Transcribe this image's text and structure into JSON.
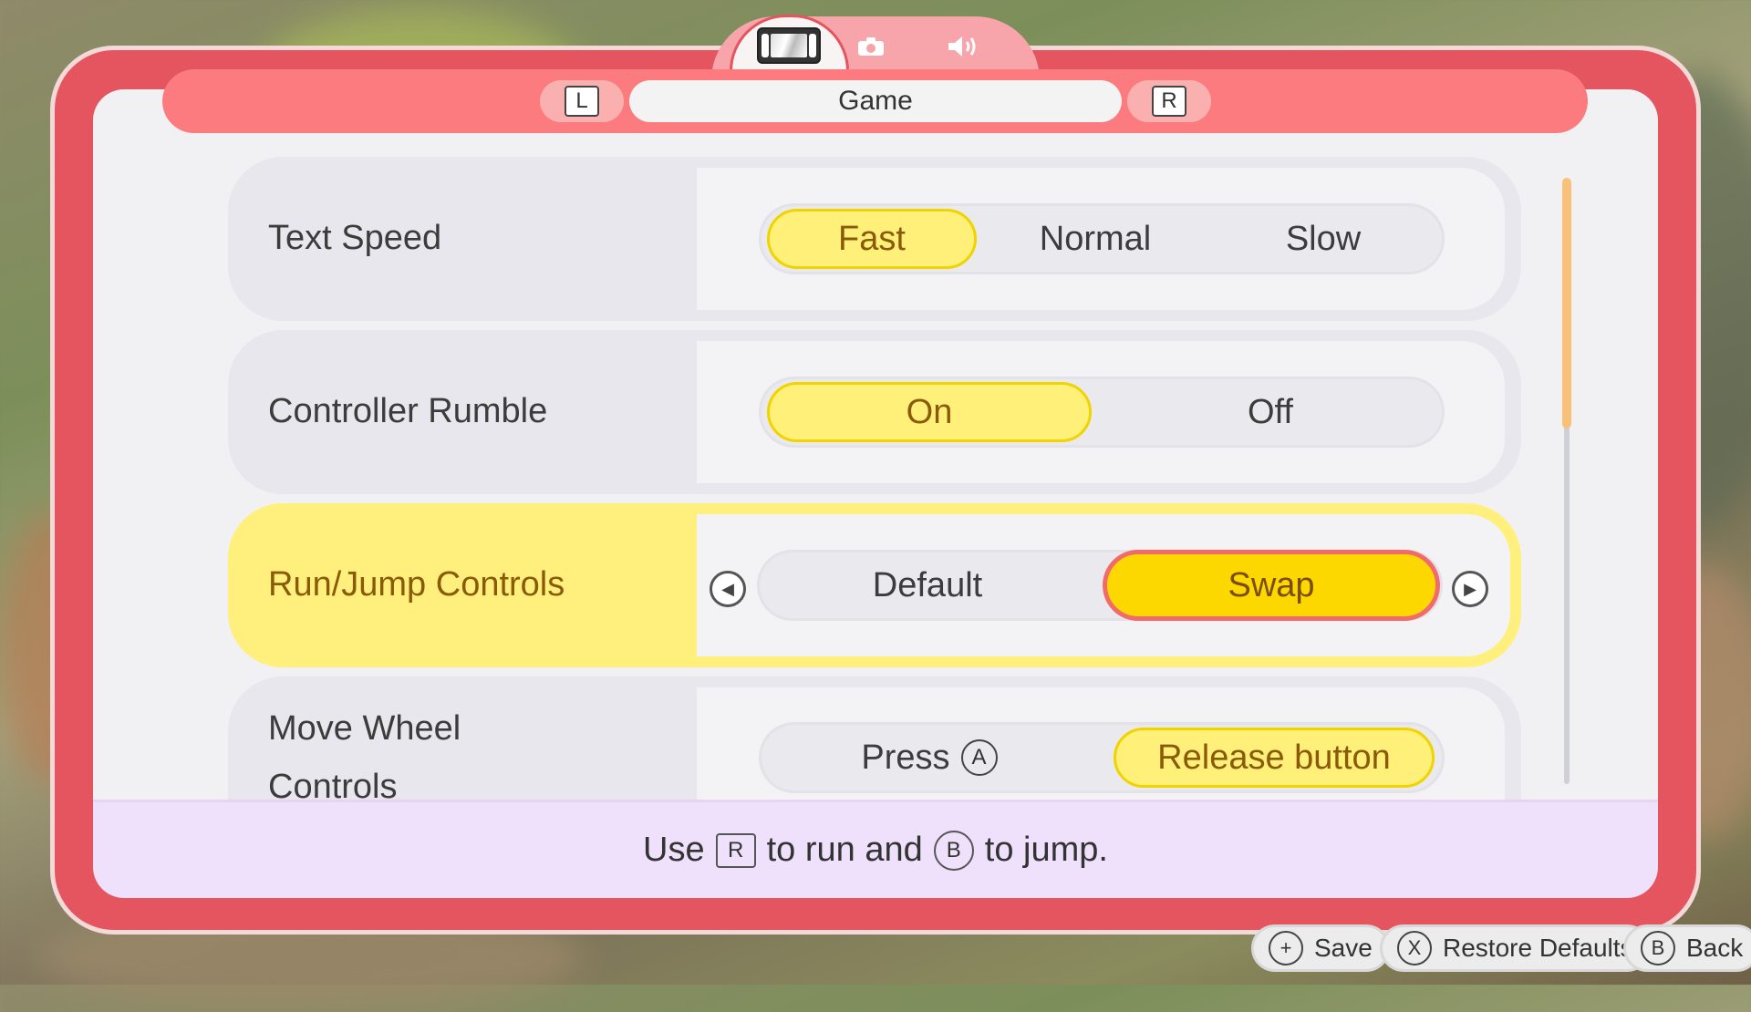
{
  "tabs": {
    "active": "switch-icon",
    "others": [
      "camera-icon",
      "speaker-icon"
    ],
    "left_key": "L",
    "right_key": "R",
    "title": "Game"
  },
  "settings": [
    {
      "label": "Text Speed",
      "options": [
        "Fast",
        "Normal",
        "Slow"
      ],
      "selected": "Fast"
    },
    {
      "label": "Controller Rumble",
      "options": [
        "On",
        "Off"
      ],
      "selected": "On"
    },
    {
      "label": "Run/Jump Controls",
      "options": [
        "Default",
        "Swap"
      ],
      "selected": "Swap"
    },
    {
      "label_line1": "Move Wheel",
      "label_line2": "Controls",
      "options": [
        "Press",
        "Release button"
      ],
      "press_key": "A",
      "selected": "Release button"
    }
  ],
  "description": {
    "part1": "Use",
    "key1": "R",
    "part2": "to run and",
    "key2": "B",
    "part3": "to jump."
  },
  "footer": {
    "save": {
      "glyph": "+",
      "label": "Save"
    },
    "restore": {
      "glyph": "X",
      "label": "Restore Defaults"
    },
    "back": {
      "glyph": "B",
      "label": "Back"
    }
  },
  "colors": {
    "frame": "#e5555f",
    "header": "#fb7b7f",
    "selected": "#fff07a",
    "highlight": "#fcd800",
    "scroll_thumb": "#f9c27b"
  }
}
